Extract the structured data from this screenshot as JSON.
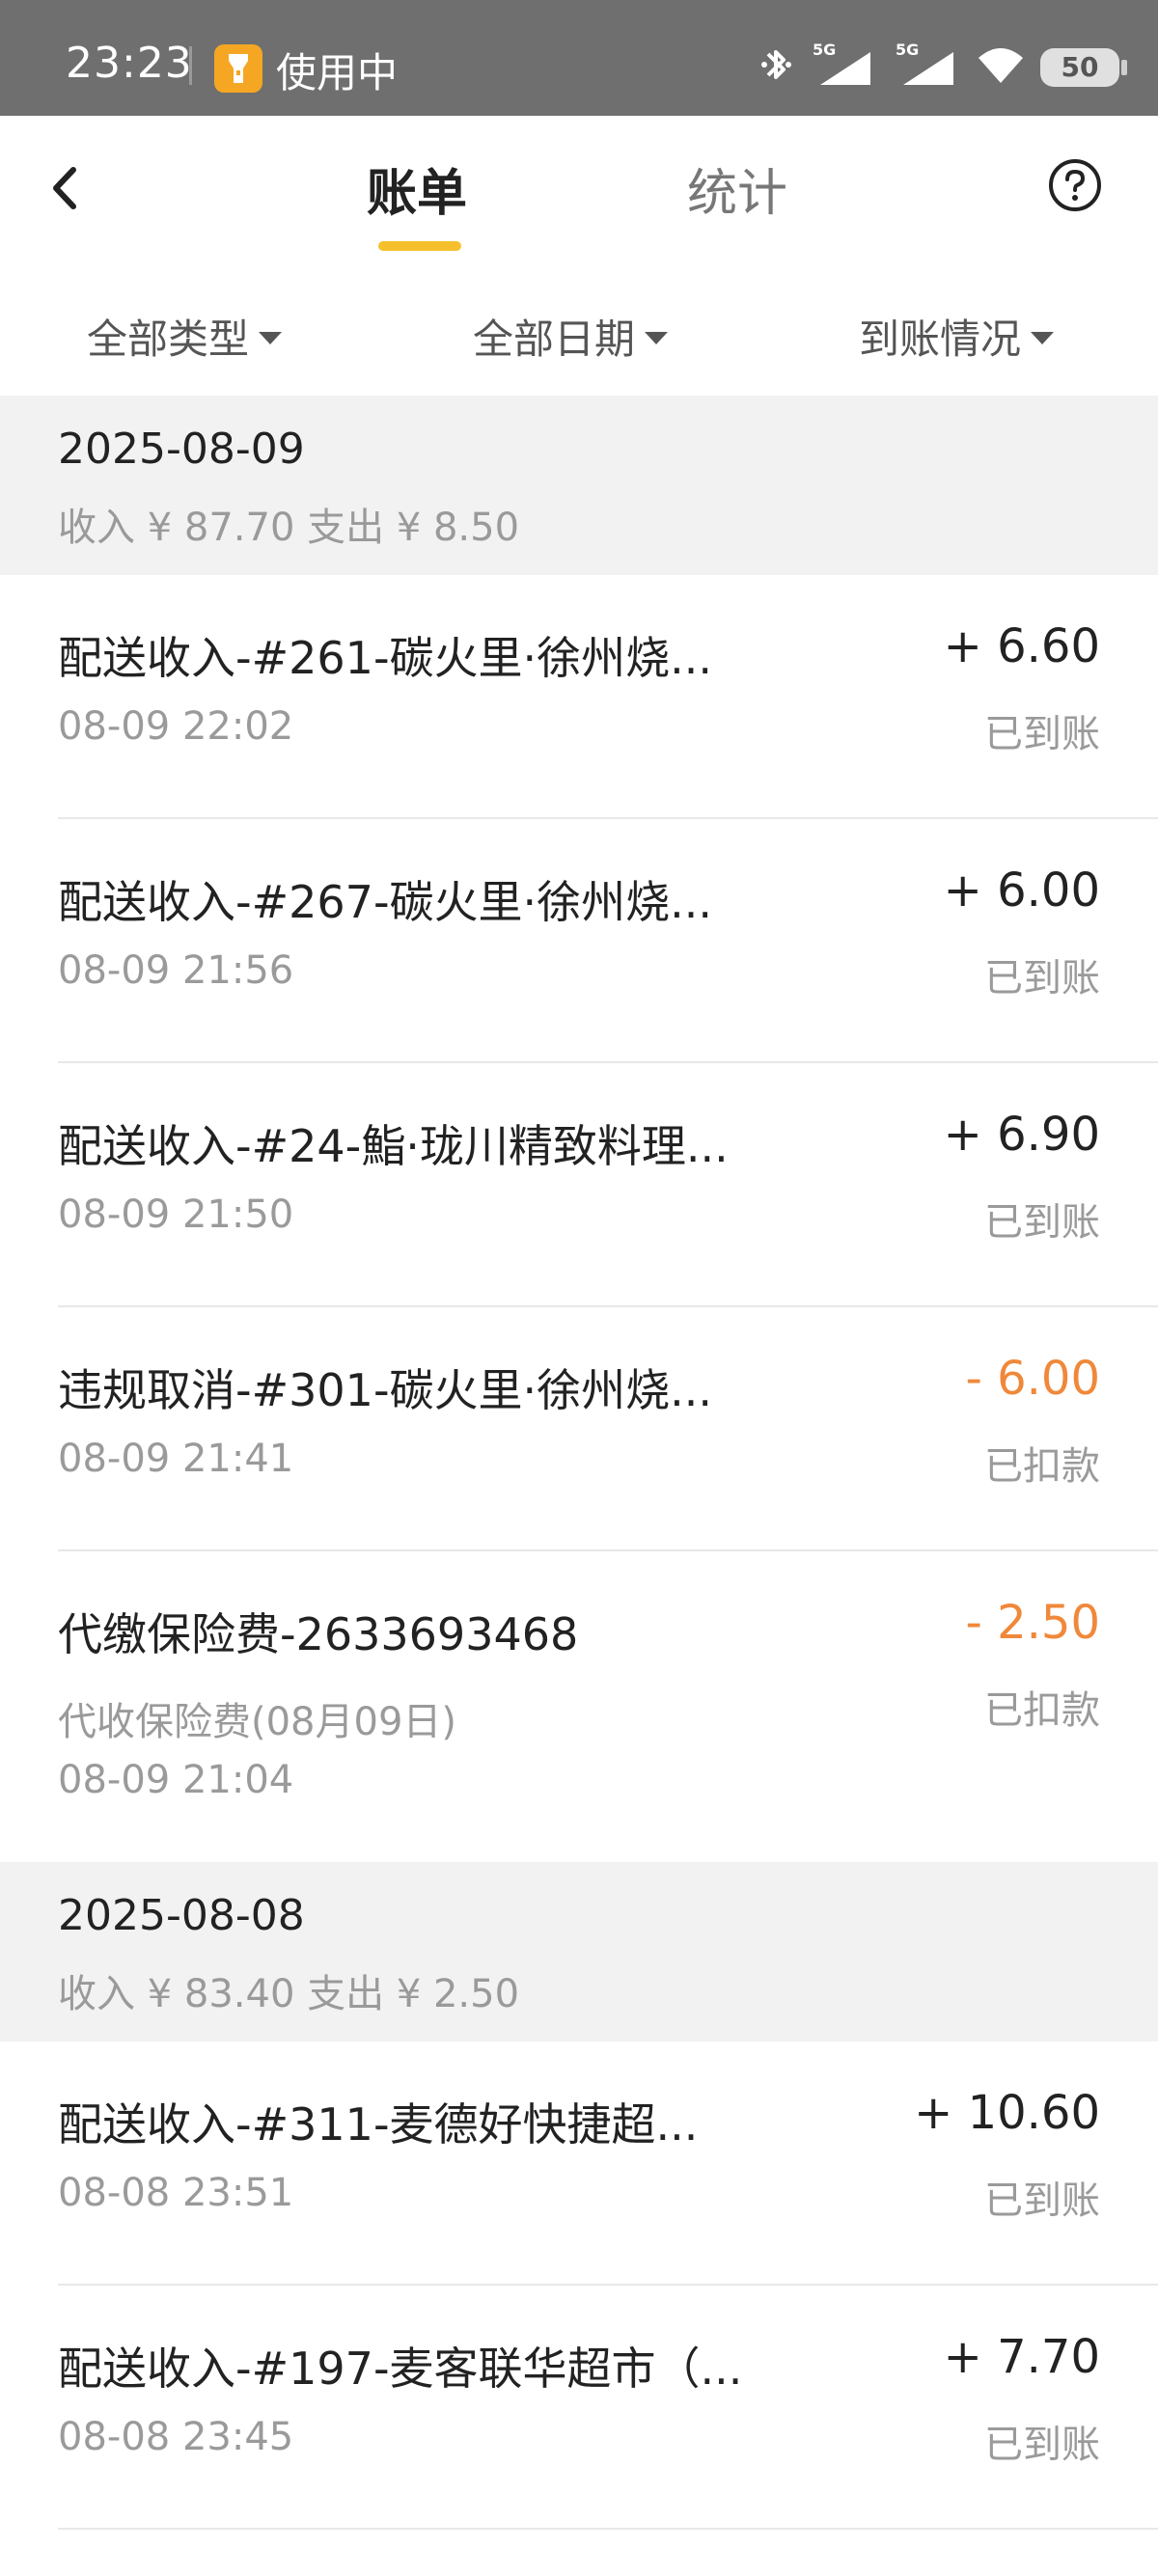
{
  "status_bar": {
    "time": "23:23",
    "indicator_label": "使用中",
    "network_label_1": "5G",
    "network_label_2": "5G",
    "battery": "50",
    "icons": [
      "flashlight-icon",
      "bluetooth-icon",
      "signal-icon",
      "signal-icon",
      "wifi-icon",
      "battery-icon"
    ]
  },
  "header": {
    "tabs": [
      {
        "label": "账单",
        "active": true
      },
      {
        "label": "统计",
        "active": false
      }
    ],
    "icons": [
      "back-icon",
      "help-icon"
    ]
  },
  "filters": [
    {
      "label": "全部类型"
    },
    {
      "label": "全部日期"
    },
    {
      "label": "到账情况"
    }
  ],
  "groups": [
    {
      "date": "2025-08-09",
      "summary": "收入 ¥ 87.70 支出 ¥ 8.50",
      "items": [
        {
          "title": "配送收入-#261-碳火里·徐州烧...",
          "time": "08-09 22:02",
          "amount": "+ 6.60",
          "status": "已到账"
        },
        {
          "title": "配送收入-#267-碳火里·徐州烧...",
          "time": "08-09 21:56",
          "amount": "+ 6.00",
          "status": "已到账"
        },
        {
          "title": "配送收入-#24-鮨·珑川精致料理...",
          "time": "08-09 21:50",
          "amount": "+ 6.90",
          "status": "已到账"
        },
        {
          "title": "违规取消-#301-碳火里·徐州烧...",
          "time": "08-09 21:41",
          "amount": "- 6.00",
          "status": "已扣款"
        },
        {
          "title": "代缴保险费-2633693468",
          "subtitle": "代收保险费(08月09日)",
          "time": "08-09 21:04",
          "amount": "- 2.50",
          "status": "已扣款"
        }
      ]
    },
    {
      "date": "2025-08-08",
      "summary": "收入 ¥ 83.40 支出 ¥ 2.50",
      "items": [
        {
          "title": "配送收入-#311-麦德好快捷超...",
          "time": "08-08 23:51",
          "amount": "+ 10.60",
          "status": "已到账"
        },
        {
          "title": "配送收入-#197-麦客联华超市（...",
          "time": "08-08 23:45",
          "amount": "+ 7.70",
          "status": "已到账"
        }
      ]
    }
  ],
  "colors": {
    "accent": "#f5c02c",
    "negative_amount": "#f0883a",
    "status_bar_bg": "#6f6f6f",
    "group_bg": "#f2f2f2",
    "muted_text": "#9a9a9a"
  }
}
